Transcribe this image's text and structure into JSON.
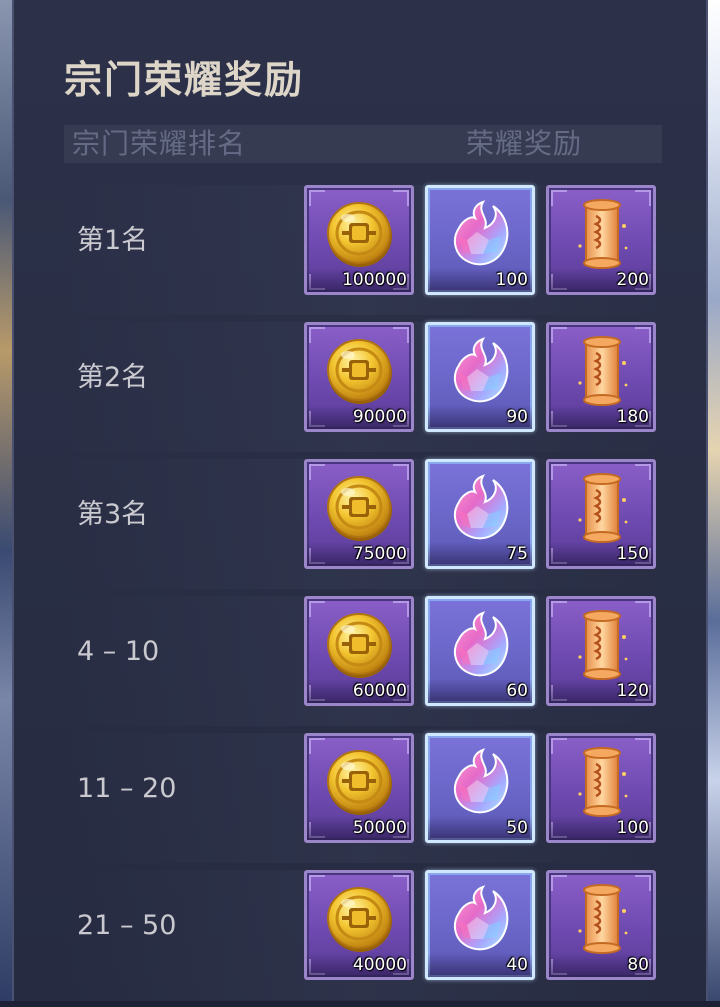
{
  "panel": {
    "title": "宗门荣耀奖励",
    "header": {
      "rank_label": "宗门荣耀排名",
      "reward_label": "荣耀奖励"
    }
  },
  "rows": [
    {
      "rank": "第1名",
      "rewards": [
        {
          "icon": "gold-coin-icon",
          "qty": "100000"
        },
        {
          "icon": "crystal-flame-icon",
          "qty": "100"
        },
        {
          "icon": "golden-scroll-icon",
          "qty": "200"
        }
      ]
    },
    {
      "rank": "第2名",
      "rewards": [
        {
          "icon": "gold-coin-icon",
          "qty": "90000"
        },
        {
          "icon": "crystal-flame-icon",
          "qty": "90"
        },
        {
          "icon": "golden-scroll-icon",
          "qty": "180"
        }
      ]
    },
    {
      "rank": "第3名",
      "rewards": [
        {
          "icon": "gold-coin-icon",
          "qty": "75000"
        },
        {
          "icon": "crystal-flame-icon",
          "qty": "75"
        },
        {
          "icon": "golden-scroll-icon",
          "qty": "150"
        }
      ]
    },
    {
      "rank": "4 – 10",
      "rewards": [
        {
          "icon": "gold-coin-icon",
          "qty": "60000"
        },
        {
          "icon": "crystal-flame-icon",
          "qty": "60"
        },
        {
          "icon": "golden-scroll-icon",
          "qty": "120"
        }
      ]
    },
    {
      "rank": "11 – 20",
      "rewards": [
        {
          "icon": "gold-coin-icon",
          "qty": "50000"
        },
        {
          "icon": "crystal-flame-icon",
          "qty": "50"
        },
        {
          "icon": "golden-scroll-icon",
          "qty": "100"
        }
      ]
    },
    {
      "rank": "21 – 50",
      "rewards": [
        {
          "icon": "gold-coin-icon",
          "qty": "40000"
        },
        {
          "icon": "crystal-flame-icon",
          "qty": "40"
        },
        {
          "icon": "golden-scroll-icon",
          "qty": "80"
        }
      ]
    }
  ],
  "colors": {
    "panel_bg": "#2a2f46",
    "title_text": "#ddd6c8",
    "header_text": "#656b84",
    "rank_text": "#c9c9cf",
    "item_purple": "#6e4ab0",
    "item_blue": "#6a66c8"
  }
}
